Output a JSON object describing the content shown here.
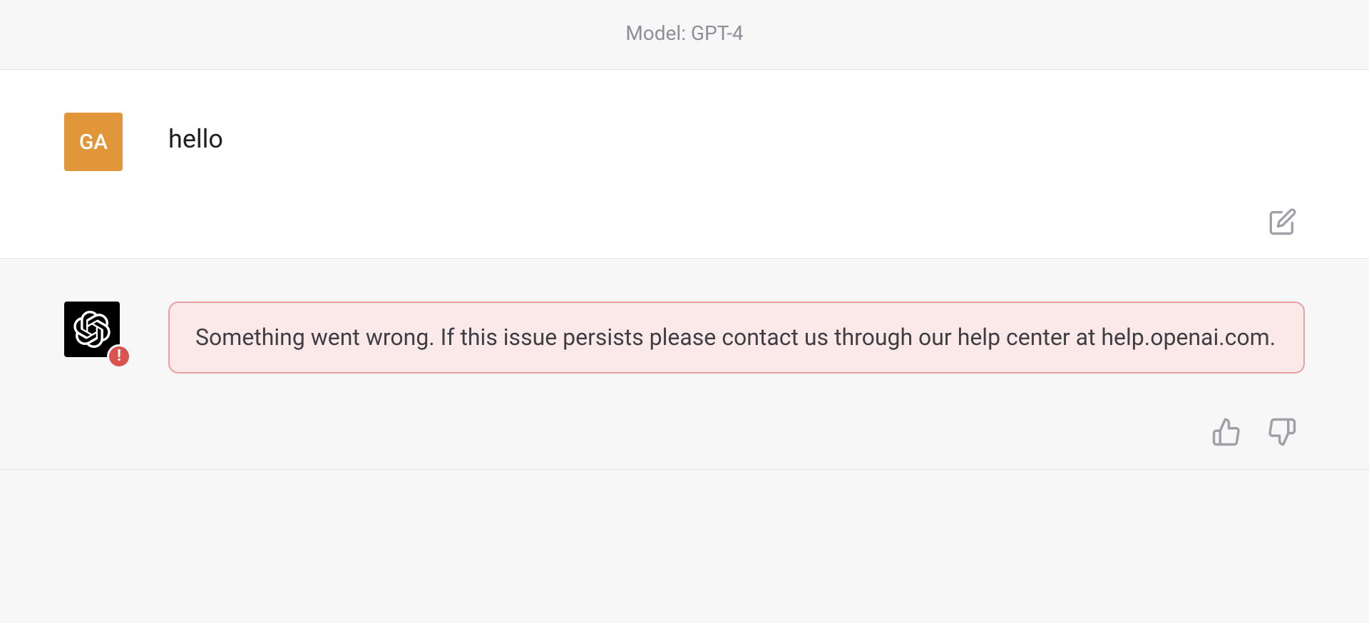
{
  "header": {
    "model_label": "Model: GPT-4"
  },
  "user_message": {
    "avatar_initials": "GA",
    "text": "hello"
  },
  "assistant_message": {
    "error_text": "Something went wrong. If this issue persists please contact us through our help center at help.openai.com."
  }
}
